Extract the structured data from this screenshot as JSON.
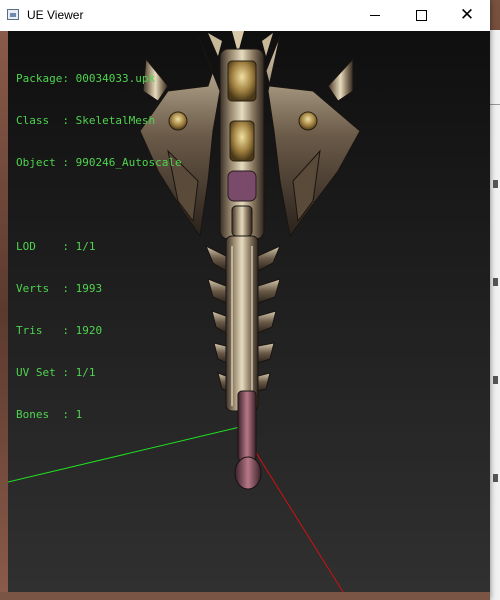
{
  "window": {
    "title": "UE Viewer",
    "controls": {
      "minimize": "minimize",
      "maximize": "maximize",
      "close": "close"
    }
  },
  "info": {
    "package_label": "Package:",
    "package_value": "00034033.upk",
    "class_label": "Class  :",
    "class_value": "SkeletalMesh",
    "object_label": "Object :",
    "object_value": "990246_Autoscale",
    "lod_label": "LOD    :",
    "lod_value": "1/1",
    "verts_label": "Verts  :",
    "verts_value": "1993",
    "tris_label": "Tris   :",
    "tris_value": "1920",
    "uvset_label": "UV Set :",
    "uvset_value": "1/1",
    "bones_label": "Bones  :",
    "bones_value": "1"
  },
  "colors": {
    "info_label": "#4fd44f",
    "info_value": "#ffffff",
    "axis_green": "#20e020",
    "axis_red": "#d01010"
  },
  "icons": {
    "app": "app-window-icon",
    "minimize": "minimize-icon",
    "maximize": "maximize-icon",
    "close": "close-icon"
  }
}
